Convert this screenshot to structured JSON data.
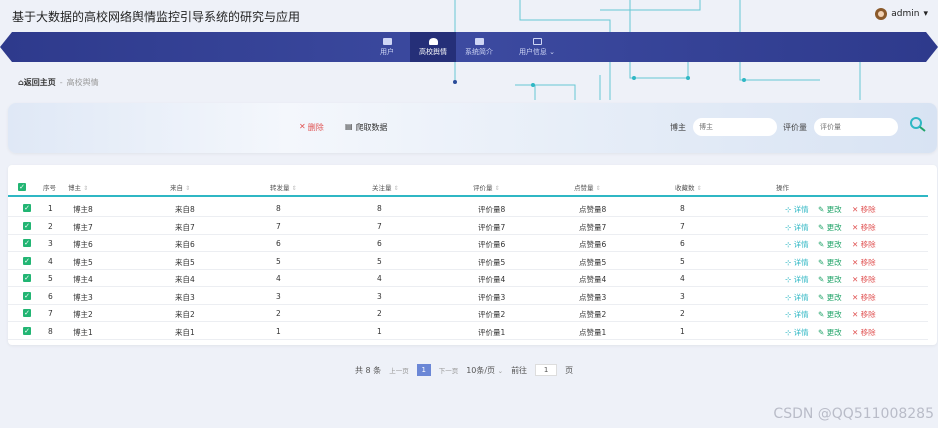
{
  "app": {
    "title": "基于大数据的高校网络舆情监控引导系统的研究与应用"
  },
  "user": {
    "name": "admin"
  },
  "nav": [
    {
      "label": "用户"
    },
    {
      "label": "高校舆情"
    },
    {
      "label": "系统简介"
    },
    {
      "label": "用户信息"
    }
  ],
  "breadcrumb": {
    "home": "返回主页",
    "current": "高校舆情"
  },
  "toolbar": {
    "delete_label": "删除",
    "collect_label": "爬取数据"
  },
  "search": {
    "blogger_label": "博主",
    "blogger_placeholder": "博主",
    "comment_label": "评价量",
    "comment_placeholder": "评价量"
  },
  "table": {
    "headers": [
      "序号",
      "博主",
      "来自",
      "转发量",
      "关注量",
      "评价量",
      "点赞量",
      "收藏数",
      "操作"
    ],
    "actions": {
      "detail": "详情",
      "edit": "更改",
      "delete": "移除"
    },
    "rows": [
      {
        "idx": "1",
        "blogger": "博主8",
        "from": "来自8",
        "forward": "8",
        "follow": "8",
        "comment": "评价量8",
        "like": "点赞量8",
        "fav": "8"
      },
      {
        "idx": "2",
        "blogger": "博主7",
        "from": "来自7",
        "forward": "7",
        "follow": "7",
        "comment": "评价量7",
        "like": "点赞量7",
        "fav": "7"
      },
      {
        "idx": "3",
        "blogger": "博主6",
        "from": "来自6",
        "forward": "6",
        "follow": "6",
        "comment": "评价量6",
        "like": "点赞量6",
        "fav": "6"
      },
      {
        "idx": "4",
        "blogger": "博主5",
        "from": "来自5",
        "forward": "5",
        "follow": "5",
        "comment": "评价量5",
        "like": "点赞量5",
        "fav": "5"
      },
      {
        "idx": "5",
        "blogger": "博主4",
        "from": "来自4",
        "forward": "4",
        "follow": "4",
        "comment": "评价量4",
        "like": "点赞量4",
        "fav": "4"
      },
      {
        "idx": "6",
        "blogger": "博主3",
        "from": "来自3",
        "forward": "3",
        "follow": "3",
        "comment": "评价量3",
        "like": "点赞量3",
        "fav": "3"
      },
      {
        "idx": "7",
        "blogger": "博主2",
        "from": "来自2",
        "forward": "2",
        "follow": "2",
        "comment": "评价量2",
        "like": "点赞量2",
        "fav": "2"
      },
      {
        "idx": "8",
        "blogger": "博主1",
        "from": "来自1",
        "forward": "1",
        "follow": "1",
        "comment": "评价量1",
        "like": "点赞量1",
        "fav": "1"
      }
    ]
  },
  "pager": {
    "total": "共 8 条",
    "prev": "上一页",
    "page": "1",
    "next": "下一页",
    "size": "10条/页",
    "goto_label": "前往",
    "goto_value": "1",
    "page_unit": "页"
  },
  "watermark": "CSDN @QQ511008285"
}
